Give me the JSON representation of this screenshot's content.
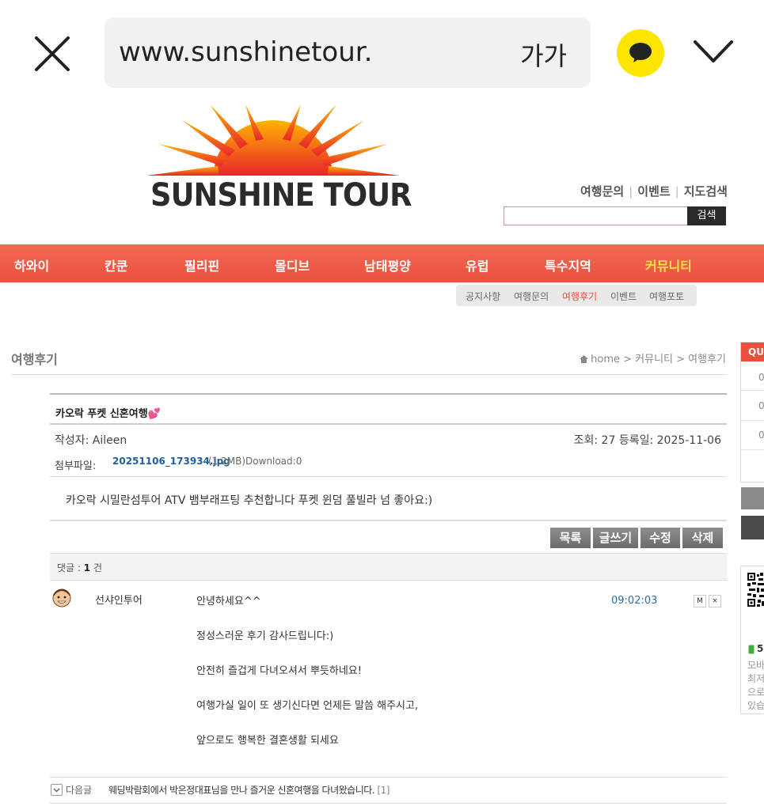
{
  "browser": {
    "url": "www.sunshinetour.",
    "font_size_label": "가가"
  },
  "site": {
    "logo_text": "SUNSHINE TOUR",
    "util_links": [
      "여행문의",
      "이벤트",
      "지도검색"
    ],
    "search_button": "검색",
    "search_value": ""
  },
  "nav": {
    "items": [
      "하와이",
      "칸쿤",
      "필리핀",
      "몰디브",
      "남태평양",
      "유럽",
      "특수지역",
      "커뮤니티"
    ],
    "active": "커뮤니티"
  },
  "subnav": {
    "items": [
      "공지사항",
      "여행문의",
      "여행후기",
      "이벤트",
      "여행포토"
    ],
    "active": "여행후기"
  },
  "page": {
    "title": "여행후기",
    "breadcrumb": "home > 커뮤니티 > 여행후기"
  },
  "quick_panel": {
    "head": "QUI",
    "nums": [
      "0",
      "0",
      "0"
    ],
    "qr_lines": [
      "5",
      "모바",
      "최저",
      "으로",
      "있습"
    ]
  },
  "post": {
    "title": "카오락 푸켓 신혼여행💕",
    "author_label": "작성자: Aileen",
    "meta": "조회: 27 등록일: 2025-11-06",
    "attach_label": "첨부파일:",
    "attach_file": "20251106_173934.jpg",
    "attach_size": "(1.2MB)",
    "attach_download": "Download:0",
    "body": "카오락 시밀란섬투어 ATV 뱀부래프팅 추천합니다 푸켓 윈덤 풀빌라 넘 좋아요:)"
  },
  "buttons": {
    "list": "목록",
    "write": "글쓰기",
    "edit": "수정",
    "delete": "삭제"
  },
  "replies": {
    "count_label": "댓글 :",
    "count": "1",
    "count_unit": "건",
    "items": [
      {
        "author": "선샤인투어",
        "time": "09:02:03",
        "lines": [
          "안녕하세요^^",
          "정성스러운 후기 감사드립니다:)",
          "안전히 즐겁게 다녀오셔서 뿌듯하네요!",
          "여행가실 일이 또 생기신다면 언제든 말씀 해주시고,",
          "앞으로도 행복한 결혼생활 되세요"
        ],
        "modify_label": "M",
        "delete_label": "×"
      }
    ]
  },
  "next_post": {
    "label": "다음글",
    "title": "웨딩박람회에서 박은정대표님을 만나 즐거운 신혼여행을 다녀왔습니다.",
    "count": "[1]"
  },
  "colors": {
    "nav_red": "#e9503d",
    "nav_active": "#ffe24d",
    "kakao_yellow": "#fde500",
    "link_blue": "#1d5fa0"
  }
}
